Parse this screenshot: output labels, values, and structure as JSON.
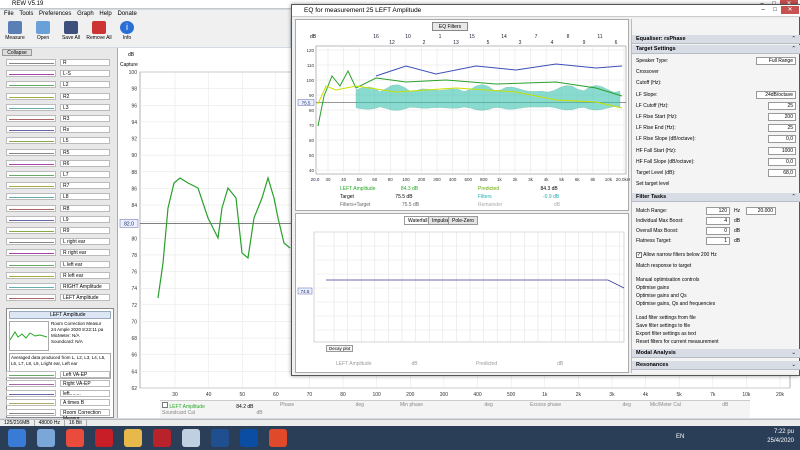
{
  "rew": {
    "title": "REW V5.19",
    "menu": [
      "File",
      "Tools",
      "Preferences",
      "Graph",
      "Help",
      "Donate"
    ],
    "toolbar": [
      "Measure",
      "Open",
      "Save All",
      "Remove All",
      "Info"
    ],
    "collapse": "Collapse",
    "measurements": [
      "R",
      "L-S",
      "L2",
      "R2",
      "L3",
      "R3",
      "Rs",
      "L5",
      "R5",
      "R6",
      "L7",
      "R7",
      "L8",
      "R8",
      "L9",
      "R9",
      "L right ear",
      "R right ear",
      "L left ear",
      "R left ear",
      "RIGHT Amplitude",
      "LEFT Amplitude"
    ],
    "selected": {
      "name": "LEFT Amplitude",
      "info": [
        "Room Correction Measur",
        "24 Ample 2020 8:22:11 pa",
        "MicMeter: N/A",
        "Soundcard: N/A"
      ],
      "note": "Averaged data produced from L, L2, L3, L4, L5, L6, L7, L8, L9, Lright ear, Left ear"
    },
    "below": [
      {
        "label": "Left VA-EP",
        "color": "#6a6"
      },
      {
        "label": "Right VA-EP",
        "color": "#a6a"
      },
      {
        "label": "left........",
        "color": "#66a"
      },
      {
        "label": "A times B",
        "color": "#aa6"
      },
      {
        "label": "Room Correction Measur",
        "color": "#888"
      }
    ],
    "capture": "Capture",
    "main_graph": {
      "y_unit": "dB",
      "y_ticks": [
        "100",
        "98",
        "96",
        "94",
        "92",
        "90",
        "88",
        "86",
        "84",
        "82",
        "80",
        "78",
        "76",
        "74",
        "72",
        "70",
        "68",
        "66",
        "64",
        "62"
      ],
      "x_ticks": [
        "30",
        "40",
        "50",
        "60",
        "70",
        "80",
        "100",
        "200",
        "300",
        "400",
        "500",
        "1k",
        "2k",
        "3k",
        "4k",
        "5k",
        "7k",
        "10k",
        "20k"
      ],
      "marker": "82.0"
    },
    "legend": [
      {
        "label": "LEFT Amplitude",
        "value": "84.2 dB",
        "color": "#2a2"
      },
      {
        "label": "Phase",
        "value": "deg"
      },
      {
        "label": "Min phase",
        "value": "deg"
      },
      {
        "label": "Excess phase",
        "value": "deg"
      },
      {
        "label": "Mic/Meter Cal",
        "value": "dB"
      },
      {
        "label": "Soundcard Cal",
        "value": "dB"
      }
    ],
    "status": [
      "125/216MB",
      "48000 Hz",
      "16 Bit"
    ]
  },
  "eq": {
    "title": "EQ for measurement 25 LEFT Amplitude",
    "filters_btn": "EQ Filters",
    "upper_graph": {
      "y_unit": "dB",
      "y_ticks": [
        "120",
        "110",
        "100",
        "90",
        "80",
        "70",
        "60",
        "50",
        "40"
      ],
      "x_ticks": [
        "30",
        "40",
        "50",
        "60",
        "80",
        "100",
        "200",
        "300",
        "400",
        "600",
        "800",
        "1k",
        "2k",
        "3k",
        "4k",
        "5k",
        "6k",
        "8k",
        "10k",
        "20.0kHz"
      ],
      "top_marks": [
        "16",
        "12",
        "10",
        "2",
        "1",
        "13",
        "15",
        "5",
        "14",
        "3",
        "7",
        "4",
        "8",
        "9",
        "11",
        "6"
      ],
      "marker": "75.5",
      "x_start": "20.0"
    },
    "upper_legend": [
      {
        "label": "LEFT Amplitude",
        "value": "84.3 dB",
        "color": "#2a2"
      },
      {
        "label": "Predicted",
        "value": "84.3 dB",
        "color": "#c8e000"
      },
      {
        "label": "Target",
        "value": "75.5 dB",
        "color": "#222"
      },
      {
        "label": "Filters",
        "value": "-0.9 dB",
        "color": "#2aa"
      },
      {
        "label": "Filters+Target",
        "value": "75.5 dB",
        "color": "#888"
      },
      {
        "label": "Remainder",
        "value": "dB",
        "color": "#aaa"
      }
    ],
    "tabs": [
      "Waterfall",
      "Impulse",
      "Pole-Zero"
    ],
    "lower_legend": [
      {
        "label": "LEFT Amplitude",
        "value": "dB"
      },
      {
        "label": "Predicted",
        "value": "dB"
      }
    ],
    "lower_marker": "74.5",
    "lower_btn": "Decay plot",
    "sections": {
      "eq_phase": "Equaliser: rsPhase",
      "target": "Target Settings",
      "filter": "Filter Tasks",
      "modal": "Modal Analysis",
      "resonances": "Resonances"
    },
    "target_fields": [
      {
        "label": "Speaker Type:",
        "value": "Full Range"
      },
      {
        "label": "Crossover",
        "value": ""
      },
      {
        "label": "Cutoff (Hz):",
        "value": ""
      },
      {
        "label": "LF Slope:",
        "value": "24dB/octave"
      },
      {
        "label": "LF Cutoff (Hz):",
        "value": "25"
      },
      {
        "label": "LF Rise Start (Hz):",
        "value": "200"
      },
      {
        "label": "LF Rise End (Hz):",
        "value": "25"
      },
      {
        "label": "LF Rise Slope (dB/octave):",
        "value": "0,0"
      },
      {
        "label": "HF Fall Start (Hz):",
        "value": "1000"
      },
      {
        "label": "HF Fall Slope (dB/octave):",
        "value": "0,0"
      },
      {
        "label": "Target Level (dB):",
        "value": "68,0"
      },
      {
        "label": "Set target level",
        "value": ""
      }
    ],
    "match_range": {
      "label": "Match Range:",
      "from": "120",
      "to": "20.000",
      "unit": "Hz"
    },
    "filter_fields": [
      {
        "label": "Individual Max Boost:",
        "value": "4",
        "unit": "dB"
      },
      {
        "label": "Overall Max Boost:",
        "value": "0",
        "unit": "dB"
      },
      {
        "label": "Flatness Target:",
        "value": "1",
        "unit": "dB"
      }
    ],
    "narrow_check": "Allow narrow filters below 200 Hz",
    "filter_actions": [
      "Match response to target",
      "Manual optimisation controls",
      "Optimise gains",
      "Optimise gains and Qs",
      "Optimise gains, Qs and frequencies",
      "Load filter settings from file",
      "Save filter settings to file",
      "Export filter settings as text",
      "Reset filters for current measurement"
    ]
  },
  "taskbar": {
    "lang": "EN",
    "time": "7:22 pu",
    "date": "25/4/2020",
    "apps": [
      {
        "name": "start",
        "color": "#3a7bd5"
      },
      {
        "name": "explorer",
        "color": "#7aa7d8"
      },
      {
        "name": "chrome",
        "color": "#e94c3d"
      },
      {
        "name": "opera",
        "color": "#c81e28"
      },
      {
        "name": "files",
        "color": "#e8b84a"
      },
      {
        "name": "calc",
        "color": "#b8222a"
      },
      {
        "name": "paint",
        "color": "#c0d0e0"
      },
      {
        "name": "media",
        "color": "#1f4f8f"
      },
      {
        "name": "rew",
        "color": "#0b4da2"
      },
      {
        "name": "player",
        "color": "#e04a2a"
      }
    ]
  }
}
